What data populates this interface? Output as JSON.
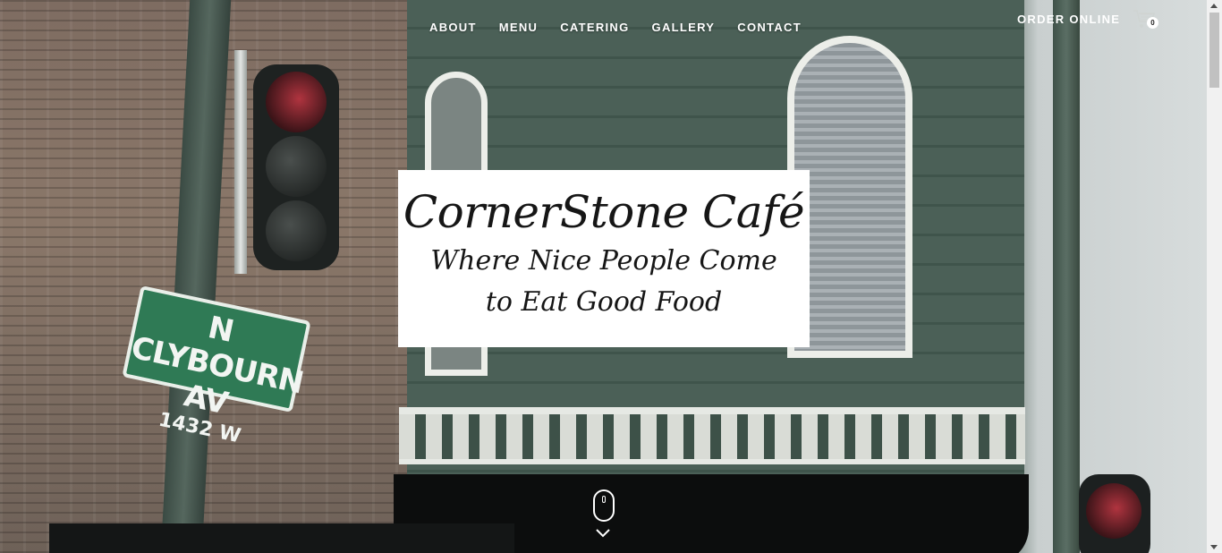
{
  "nav": {
    "items": [
      {
        "label": "ABOUT"
      },
      {
        "label": "MENU"
      },
      {
        "label": "CATERING"
      },
      {
        "label": "GALLERY"
      },
      {
        "label": "CONTACT"
      }
    ],
    "order_online": "ORDER ONLINE",
    "cart_count": "0"
  },
  "hero": {
    "title": "CornerStone Café",
    "tagline_line1": "Where Nice People Come",
    "tagline_line2": "to Eat Good Food",
    "street_sign_line1": "N CLYBOURN AV",
    "street_sign_line2": "1432 W"
  },
  "icons": {
    "cart": "cart-icon",
    "scroll": "mouse-scroll-icon",
    "chevron": "chevron-down-icon"
  }
}
